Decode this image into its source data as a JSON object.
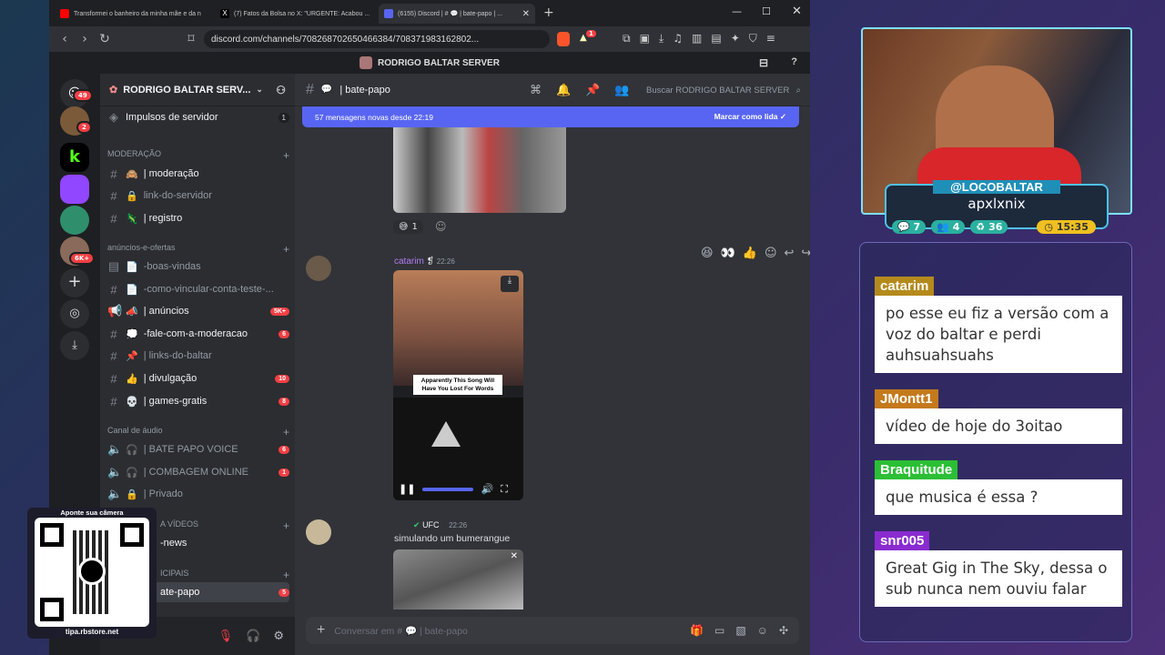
{
  "browser": {
    "tabs": [
      {
        "title": "Transformei o banheiro da minha mãe e da n",
        "color": "#ff0000"
      },
      {
        "title": "(7) Fatos da Bolsa no X: \"URGENTE: Acabou ...",
        "color": "#111111"
      },
      {
        "title": "(6155) Discord | # 💬 | bate-papo | ...",
        "color": "#5865f2"
      }
    ],
    "url": "discord.com/channels/708268702650466384/708371983162802...",
    "window_title": "RODRIGO BALTAR SERVER",
    "shield_count": "1"
  },
  "rail": {
    "badges": [
      "49",
      "2",
      "6K+"
    ]
  },
  "server": {
    "name": "RODRIGO BALTAR SERV...",
    "boost_label": "Impulsos de servidor",
    "boost_count": "1",
    "categories": {
      "moderacao": "MODERAÇÃO",
      "anuncios": "anúncios-e-ofertas",
      "audio": "Canal de áudio",
      "videos": "A VÍDEOS",
      "principais": "ICIPAIS"
    },
    "channels": [
      {
        "name": "| moderação",
        "icon": "🙈",
        "bright": true
      },
      {
        "name": "link-do-servidor",
        "icon": "🔒",
        "bright": false
      },
      {
        "name": "| registro",
        "icon": "🦎",
        "bright": true
      },
      {
        "name": "-boas-vindas",
        "icon": "📄",
        "bright": false
      },
      {
        "name": "-como-vincular-conta-teste-...",
        "icon": "📄",
        "bright": false
      },
      {
        "name": "| anúncios",
        "icon": "📣",
        "bright": true,
        "badge": "5K+"
      },
      {
        "name": "-fale-com-a-moderacao",
        "icon": "💭",
        "bright": true,
        "badge": "6"
      },
      {
        "name": "| links-do-baltar",
        "icon": "📌",
        "bright": false
      },
      {
        "name": "| divulgação",
        "icon": "👍",
        "bright": true,
        "badge": "10"
      },
      {
        "name": "| games-gratis",
        "icon": "💀",
        "bright": true,
        "badge": "8"
      },
      {
        "name": "| BATE PAPO VOICE",
        "icon": "🎧",
        "bright": false,
        "badge": "6"
      },
      {
        "name": "| COMBAGEM ONLINE",
        "icon": "🎧",
        "bright": false,
        "badge": "1"
      },
      {
        "name": "| Privado",
        "icon": "🔒",
        "bright": false
      },
      {
        "name": "-news",
        "icon": "",
        "bright": true
      },
      {
        "name": "ate-papo",
        "icon": "",
        "bright": true,
        "badge": "5"
      }
    ]
  },
  "chat": {
    "channel": "| bate-papo",
    "search_placeholder": "Buscar RODRIGO BALTAR SERVER",
    "banner": "57 mensagens novas desde 22:19",
    "mark_read": "Marcar como lida",
    "reaction_count": "1",
    "msg1": {
      "author": "catarim",
      "time": "22:26",
      "video_caption": "Apparently This Song Will Have You Lost For Words"
    },
    "msg2": {
      "author": "UFC",
      "time": "22:26",
      "text": "simulando um bumerangue"
    },
    "composer_placeholder": "Conversar em # 💬 | bate-papo"
  },
  "stream": {
    "handle": "@LOCOBALTAR",
    "subtitle": "apxlxnix",
    "stats": [
      "7",
      "4",
      "36",
      "15:35"
    ],
    "chat": [
      {
        "name": "catarim",
        "color": "#b58a1c",
        "text": "po esse eu fiz a versão com a voz do baltar e perdi auhsuahsuahs"
      },
      {
        "name": "JMontt1",
        "color": "#c47a1c",
        "text": "vídeo de hoje do 3oitao"
      },
      {
        "name": "Braquitude",
        "color": "#2bbf35",
        "text": "que musica é essa ?"
      },
      {
        "name": "snr005",
        "color": "#8a2bd0",
        "text": "Great Gig in The Sky, dessa o sub nunca nem ouviu falar"
      }
    ],
    "qr_title": "Aponte sua câmera",
    "qr_url": "tipa.rbstore.net"
  }
}
